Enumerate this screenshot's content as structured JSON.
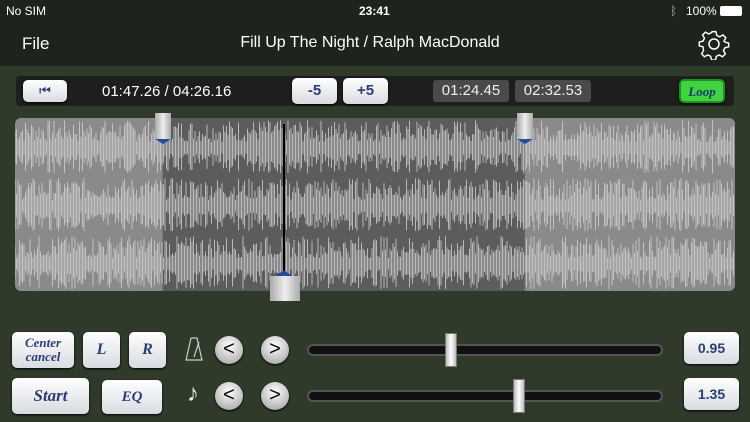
{
  "status": {
    "carrier": "No SIM",
    "time": "23:41",
    "battery": "100%"
  },
  "nav": {
    "file": "File",
    "title": "Fill Up The Night / Ralph MacDonald",
    "settings_icon": "gear-icon"
  },
  "transport": {
    "position": "01:47.26 / 04:26.16",
    "minus": "-5",
    "plus": "+5",
    "loop_start": "01:24.45",
    "loop_end": "02:32.53",
    "loop": "Loop"
  },
  "waveform": {
    "selection_start_fraction": 0.205,
    "selection_end_fraction": 0.708,
    "playhead_fraction": 0.374
  },
  "controls": {
    "center_cancel": "Center cancel",
    "left": "L",
    "right": "R",
    "start": "Start",
    "eq": "EQ",
    "tempo": {
      "value": "0.95",
      "slider_fraction": 0.4,
      "prev": "<",
      "next": ">"
    },
    "pitch": {
      "value": "1.35",
      "slider_fraction": 0.6,
      "prev": "<",
      "next": ">",
      "icon": "♪"
    }
  },
  "colors": {
    "loop_active": "#3fd33f",
    "marker": "#1d4f9a"
  }
}
